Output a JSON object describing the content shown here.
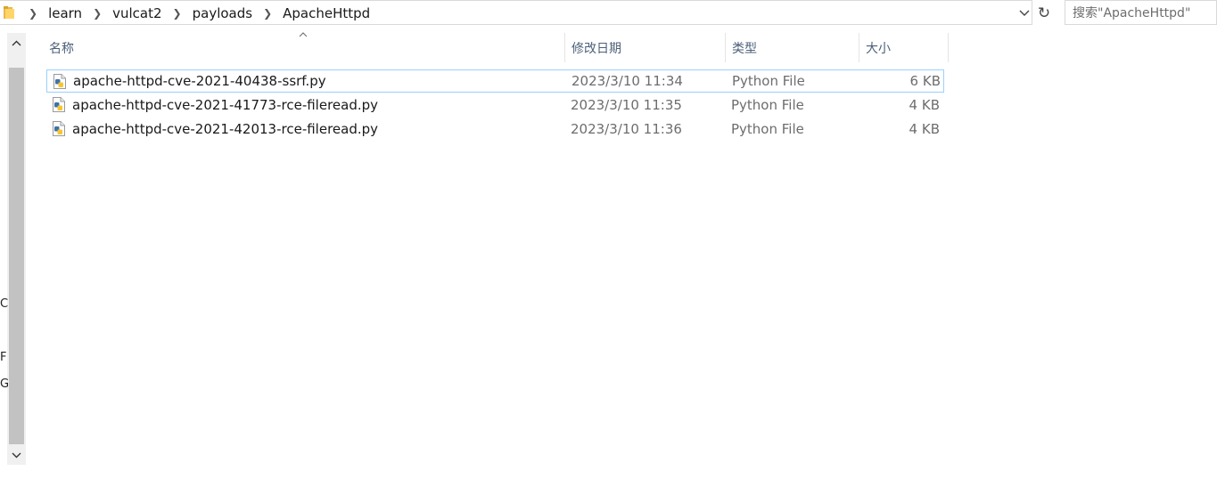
{
  "breadcrumbs": [
    "learn",
    "vulcat2",
    "payloads",
    "ApacheHttpd"
  ],
  "search": {
    "placeholder": "搜索\"ApacheHttpd\""
  },
  "columns": {
    "name": "名称",
    "modified": "修改日期",
    "type": "类型",
    "size": "大小"
  },
  "files": [
    {
      "name": "apache-httpd-cve-2021-40438-ssrf.py",
      "modified": "2023/3/10 11:34",
      "type": "Python File",
      "size": "6 KB",
      "selected": true
    },
    {
      "name": "apache-httpd-cve-2021-41773-rce-fileread.py",
      "modified": "2023/3/10 11:35",
      "type": "Python File",
      "size": "4 KB",
      "selected": false
    },
    {
      "name": "apache-httpd-cve-2021-42013-rce-fileread.py",
      "modified": "2023/3/10 11:36",
      "type": "Python File",
      "size": "4 KB",
      "selected": false
    }
  ],
  "nav_letters": [
    "C",
    "F",
    "G"
  ],
  "icons": {
    "folder": "folder-icon",
    "refresh": "refresh-icon",
    "dropdown": "chevron-down-icon",
    "file": "python-file-icon"
  },
  "colors": {
    "selection_border": "#99d1ff",
    "header_text": "#4c607a",
    "secondary_text": "#6d6d6d"
  }
}
